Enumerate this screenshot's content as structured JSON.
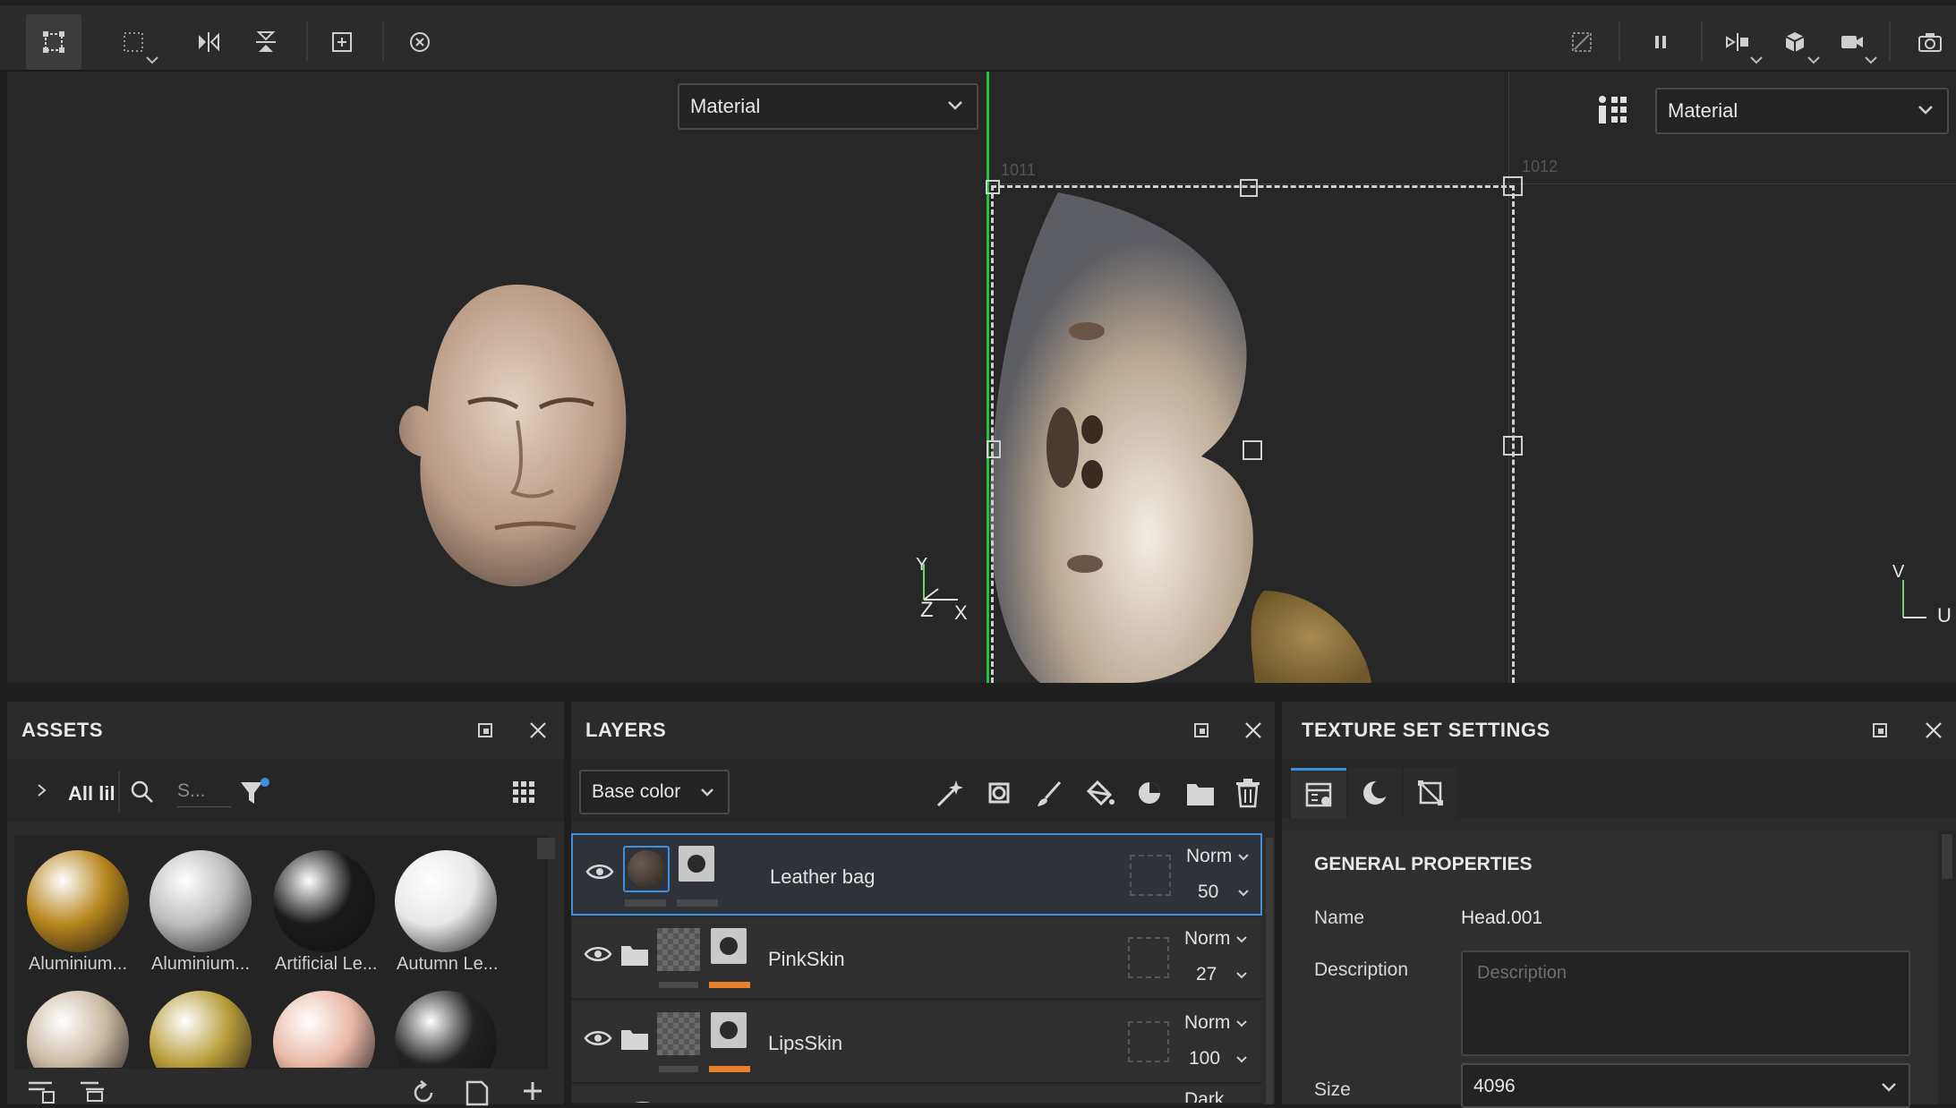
{
  "viewport3d": {
    "mode_select": "Material",
    "axis_y": "Y",
    "axis_z": "Z",
    "axis_x": "X"
  },
  "viewport2d": {
    "mode_select": "Material",
    "tile_left": "1011",
    "tile_right": "1012",
    "axis_v": "V",
    "axis_u": "U"
  },
  "assets": {
    "title": "ASSETS",
    "breadcrumb": "All lil",
    "search_placeholder": "S...",
    "items": [
      {
        "label": "Aluminium...",
        "color": "#b8861e"
      },
      {
        "label": "Aluminium...",
        "color": "#bdbdbd"
      },
      {
        "label": "Artificial Le...",
        "color": "#1a1a1a"
      },
      {
        "label": "Autumn Le...",
        "color": "#e8e8e8"
      },
      {
        "label": "",
        "color": "#c9b9a1"
      },
      {
        "label": "",
        "color": "#b89d3a"
      },
      {
        "label": "",
        "color": "#e9b8a5"
      },
      {
        "label": "",
        "color": "#222222"
      }
    ]
  },
  "layers": {
    "title": "LAYERS",
    "channel_select": "Base color",
    "rows": [
      {
        "name": "Leather bag",
        "blend": "Norm",
        "opacity": "50"
      },
      {
        "name": "PinkSkin",
        "blend": "Norm",
        "opacity": "27"
      },
      {
        "name": "LipsSkin",
        "blend": "Norm",
        "opacity": "100"
      }
    ],
    "partial_blend": "Dark"
  },
  "texture_set": {
    "title": "TEXTURE SET SETTINGS",
    "section": "GENERAL PROPERTIES",
    "name_label": "Name",
    "name_value": "Head.001",
    "description_label": "Description",
    "description_placeholder": "Description",
    "size_label": "Size",
    "size_value": "4096"
  },
  "colors": {
    "accent": "#3d8fe0",
    "orange": "#e8822b",
    "green_line": "#22c33a"
  }
}
